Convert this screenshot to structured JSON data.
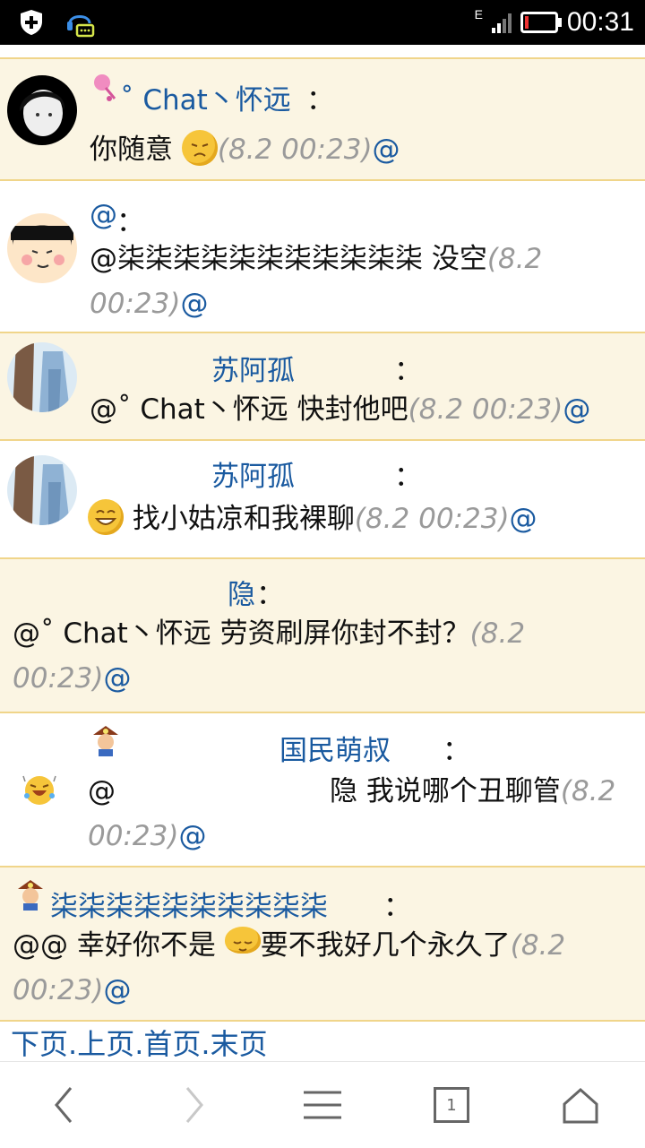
{
  "status_bar": {
    "time": "00:31",
    "network": "E"
  },
  "messages": [
    {
      "name": "˚ Chat丶怀远",
      "colon": "：",
      "text": "你随意",
      "time": "(8.2 00:23)",
      "at": "@"
    },
    {
      "name": "@",
      "colon": "：",
      "text_line1": "@柒柒柒柒柒柒柒柒柒柒柒 没空",
      "time1": "(8.2",
      "time2": "00:23)",
      "at": "@"
    },
    {
      "name": "苏阿孤",
      "colon": "：",
      "text": "@˚ Chat丶怀远 快封他吧",
      "time": "(8.2 00:23)",
      "at": "@"
    },
    {
      "name": "苏阿孤",
      "colon": "：",
      "text": "找小姑凉和我裸聊",
      "time": "(8.2 00:23)",
      "at": "@"
    },
    {
      "name": "隐",
      "colon": "：",
      "text_line1": "@˚ Chat丶怀远 劳资刷屏你封不封？",
      "time1": "(8.2",
      "time2": "00:23)",
      "at": "@"
    },
    {
      "name": "国民萌叔",
      "colon": "：",
      "at_prefix": "@",
      "text_line1": "隐 我说哪个丑聊管",
      "time1": "(8.2",
      "time2": "00:23)",
      "at": "@"
    },
    {
      "name": "柒柒柒柒柒柒柒柒柒柒",
      "colon": "：",
      "text_a": "@@ 幸好你不是",
      "text_b": "要不我好几个永久了",
      "time1": "(8.2",
      "time2": "00:23)",
      "at": "@"
    }
  ],
  "pager": {
    "next": "下页",
    "prev": "上页",
    "first": "首页",
    "last": "末页",
    "sep": "."
  },
  "navbar": {
    "tabs_count": "1",
    "icons": [
      "chevron-left-icon",
      "chevron-right-icon",
      "menu-icon",
      "tabs-icon",
      "home-icon"
    ]
  },
  "colors": {
    "name_blue": "#1a5aa0",
    "row_tan": "#fbf5e3",
    "divider": "#f0d58a",
    "time_gray": "#9a9a9a"
  }
}
